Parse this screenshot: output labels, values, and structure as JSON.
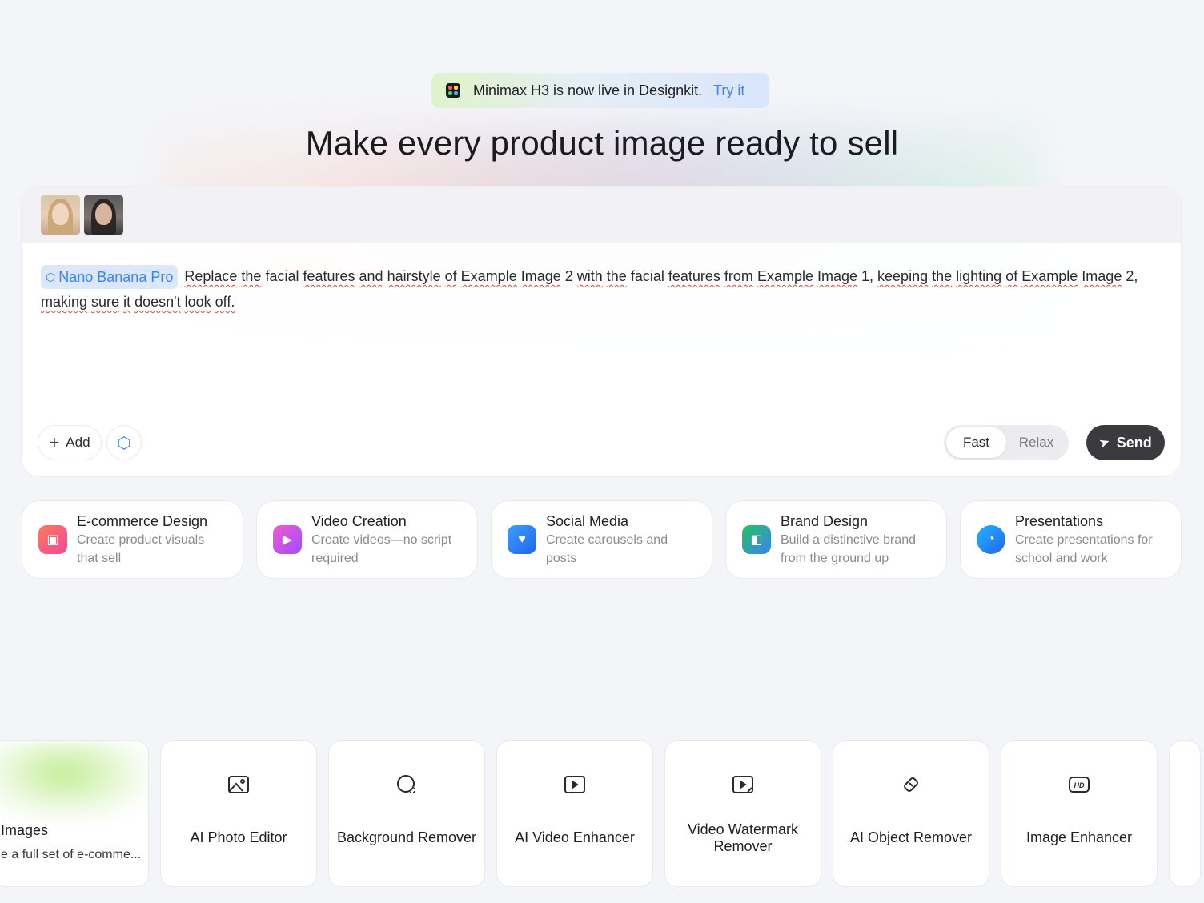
{
  "banner": {
    "text": "Minimax H3 is now live in Designkit.",
    "cta": "Try it"
  },
  "headline": "Make every product image ready to sell",
  "editor": {
    "model_chip": "Nano Banana Pro",
    "prompt_words": [
      {
        "w": "Replace",
        "sq": true
      },
      {
        "w": " "
      },
      {
        "w": "the",
        "sq": true
      },
      {
        "w": " facial "
      },
      {
        "w": "features",
        "sq": true
      },
      {
        "w": " "
      },
      {
        "w": "and",
        "sq": true
      },
      {
        "w": " "
      },
      {
        "w": "hairstyle",
        "sq": true
      },
      {
        "w": " "
      },
      {
        "w": "of",
        "sq": true
      },
      {
        "w": " "
      },
      {
        "w": "Example",
        "sq": true
      },
      {
        "w": " "
      },
      {
        "w": "Image",
        "sq": true
      },
      {
        "w": " 2 "
      },
      {
        "w": "with",
        "sq": true
      },
      {
        "w": " "
      },
      {
        "w": "the",
        "sq": true
      },
      {
        "w": " facial "
      },
      {
        "w": "features",
        "sq": true
      },
      {
        "w": " "
      },
      {
        "w": "from",
        "sq": true
      },
      {
        "w": " "
      },
      {
        "w": "Example",
        "sq": true
      },
      {
        "w": " "
      },
      {
        "w": "Image",
        "sq": true
      },
      {
        "w": " 1, "
      },
      {
        "w": "keeping",
        "sq": true
      },
      {
        "w": " "
      },
      {
        "w": "the",
        "sq": true
      },
      {
        "w": " "
      },
      {
        "w": "lighting",
        "sq": true
      },
      {
        "w": " "
      },
      {
        "w": "of",
        "sq": true
      },
      {
        "w": " "
      },
      {
        "w": "Example",
        "sq": true
      },
      {
        "w": " "
      },
      {
        "w": "Image",
        "sq": true
      },
      {
        "w": " 2, "
      },
      {
        "w": "making",
        "sq": true
      },
      {
        "w": " "
      },
      {
        "w": "sure",
        "sq": true
      },
      {
        "w": " "
      },
      {
        "w": "it",
        "sq": true
      },
      {
        "w": " "
      },
      {
        "w": "doesn't",
        "sq": true
      },
      {
        "w": " "
      },
      {
        "w": "look",
        "sq": true
      },
      {
        "w": " "
      },
      {
        "w": "off.",
        "sq": true
      }
    ],
    "add_label": "Add",
    "mode_options": [
      "Fast",
      "Relax"
    ],
    "mode_selected": "Fast",
    "send_label": "Send"
  },
  "categories": [
    {
      "title": "E-commerce Design",
      "desc": "Create product visuals that sell",
      "icon": "shopping-bag-icon",
      "colors": [
        "#ff7a59",
        "#f0489b"
      ]
    },
    {
      "title": "Video Creation",
      "desc": "Create videos—no script required",
      "icon": "play-icon",
      "colors": [
        "#f05bd0",
        "#a04cff"
      ]
    },
    {
      "title": "Social Media",
      "desc": "Create carousels and posts",
      "icon": "heart-bubble-icon",
      "colors": [
        "#3aa0ff",
        "#2563eb"
      ]
    },
    {
      "title": "Brand Design",
      "desc": "Build a distinctive brand from the ground up",
      "icon": "brand-icon",
      "colors": [
        "#22c55e",
        "#3b82f6"
      ]
    },
    {
      "title": "Presentations",
      "desc": "Create presentations for school and work",
      "icon": "pie-chart-icon",
      "colors": [
        "#1fb6ff",
        "#2563eb"
      ]
    }
  ],
  "tools": [
    {
      "name": "Images",
      "desc": "e a full set of e-comme...",
      "icon": ""
    },
    {
      "name": "AI Photo Editor",
      "icon": "photo-icon"
    },
    {
      "name": "Background Remover",
      "icon": "bg-remove-icon"
    },
    {
      "name": "AI Video Enhancer",
      "icon": "video-hd-icon"
    },
    {
      "name": "Video Watermark Remover",
      "icon": "video-eraser-icon"
    },
    {
      "name": "AI Object Remover",
      "icon": "eraser-icon"
    },
    {
      "name": "Image Enhancer",
      "icon": "hd-icon"
    }
  ]
}
